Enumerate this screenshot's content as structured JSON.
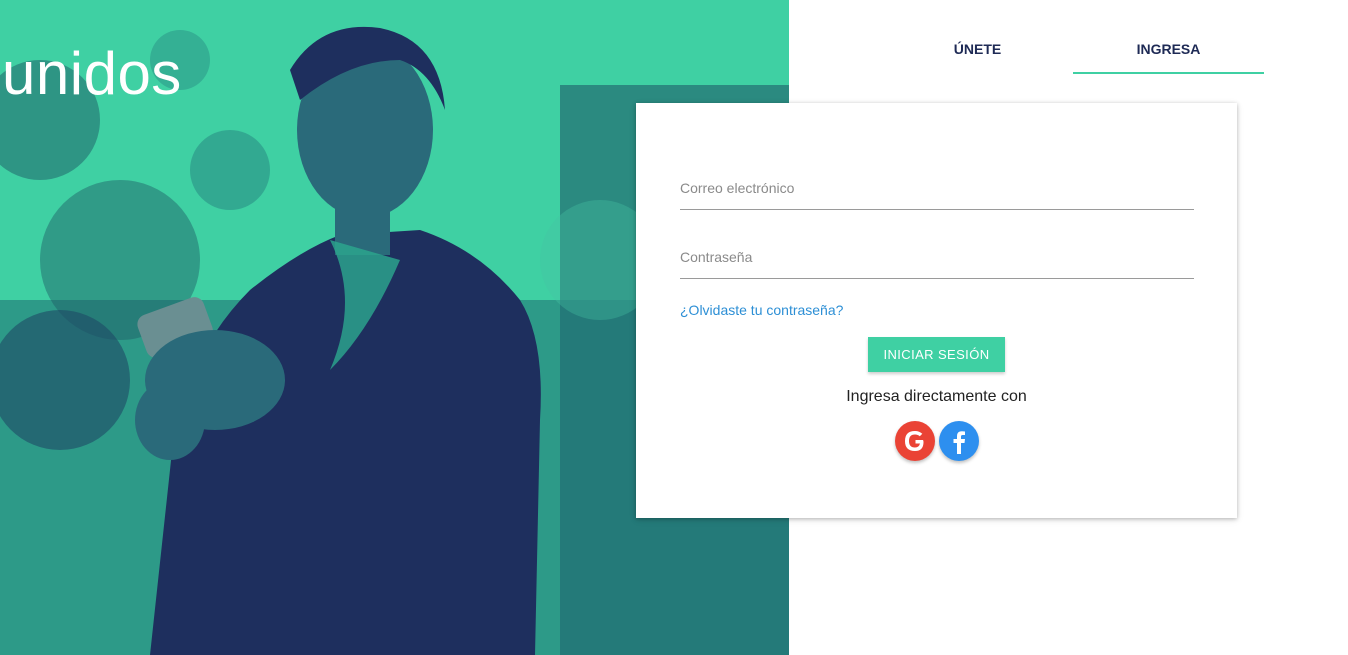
{
  "hero": {
    "title": "unidos",
    "colors": {
      "teal": "#3fd0a3",
      "navy": "#1e2a55"
    }
  },
  "tabs": [
    {
      "label": "ÚNETE"
    },
    {
      "label": "INGRESA",
      "active": true
    }
  ],
  "form": {
    "email_placeholder": "Correo electrónico",
    "password_placeholder": "Contraseña",
    "forgot_link": "¿Olvidaste tu contraseña?",
    "submit_label": "INICIAR SESIÓN",
    "social_text": "Ingresa directamente con",
    "social": [
      {
        "name": "google-icon",
        "color": "#ea4335"
      },
      {
        "name": "facebook-icon",
        "color": "#2d8fef"
      }
    ]
  }
}
